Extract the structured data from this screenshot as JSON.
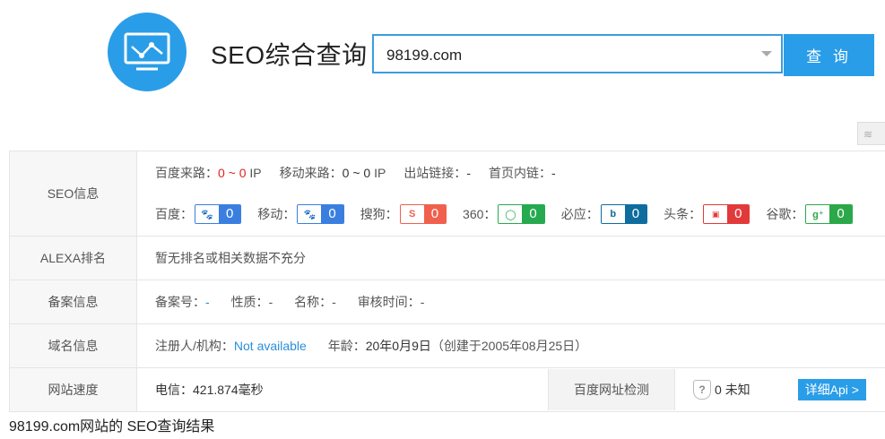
{
  "header": {
    "title": "SEO综合查询",
    "search_value": "98199.com",
    "search_button": "查 询",
    "logo_icon": "chart-monitor-icon",
    "corner_icon": "layers-icon"
  },
  "colors": {
    "accent": "#2a9de8",
    "red": "#e02222",
    "baidu": "#3a7fe0",
    "sogou": "#f0604d",
    "q360": "#26a94f",
    "bing": "#0e6d9e",
    "toutiao": "#e23a3a",
    "google": "#2ba84a"
  },
  "seo": {
    "label": "SEO信息",
    "baidu_traffic_label": "百度来路：",
    "baidu_traffic_value": "0 ~ 0",
    "baidu_traffic_unit": "IP",
    "mobile_traffic_label": "移动来路：",
    "mobile_traffic_value": "0 ~ 0",
    "mobile_traffic_unit": "IP",
    "outbound_label": "出站链接：",
    "outbound_value": "-",
    "homepage_links_label": "首页内链：",
    "homepage_links_value": "-",
    "engines": [
      {
        "label": "百度：",
        "icon": "baidu-paw-icon",
        "value": "0"
      },
      {
        "label": "移动：",
        "icon": "baidu-mobile-paw-icon",
        "value": "0"
      },
      {
        "label": "搜狗：",
        "icon": "sogou-icon",
        "value": "0"
      },
      {
        "label": "360：",
        "icon": "360-icon",
        "value": "0"
      },
      {
        "label": "必应：",
        "icon": "bing-icon",
        "value": "0"
      },
      {
        "label": "头条：",
        "icon": "toutiao-icon",
        "value": "0"
      },
      {
        "label": "谷歌：",
        "icon": "google-plus-icon",
        "value": "0"
      }
    ]
  },
  "alexa": {
    "label": "ALEXA排名",
    "value": "暂无排名或相关数据不充分"
  },
  "icp": {
    "label": "备案信息",
    "number_label": "备案号：",
    "number_value": "-",
    "nature_label": "性质：",
    "nature_value": "-",
    "name_label": "名称：",
    "name_value": "-",
    "review_label": "审核时间：",
    "review_value": "-"
  },
  "domain": {
    "label": "域名信息",
    "registrant_label": "注册人/机构：",
    "registrant_value": "Not available",
    "age_label": "年龄：",
    "age_value": "20年0月9日",
    "created": "（创建于2005年08月25日）"
  },
  "speed": {
    "label": "网站速度",
    "telecom": "电信：421.874毫秒",
    "check_label": "百度网址检测",
    "status_num": "0",
    "status_text": "未知",
    "api_button": "详细Api >"
  },
  "footer": "98199.com网站的 SEO查询结果"
}
